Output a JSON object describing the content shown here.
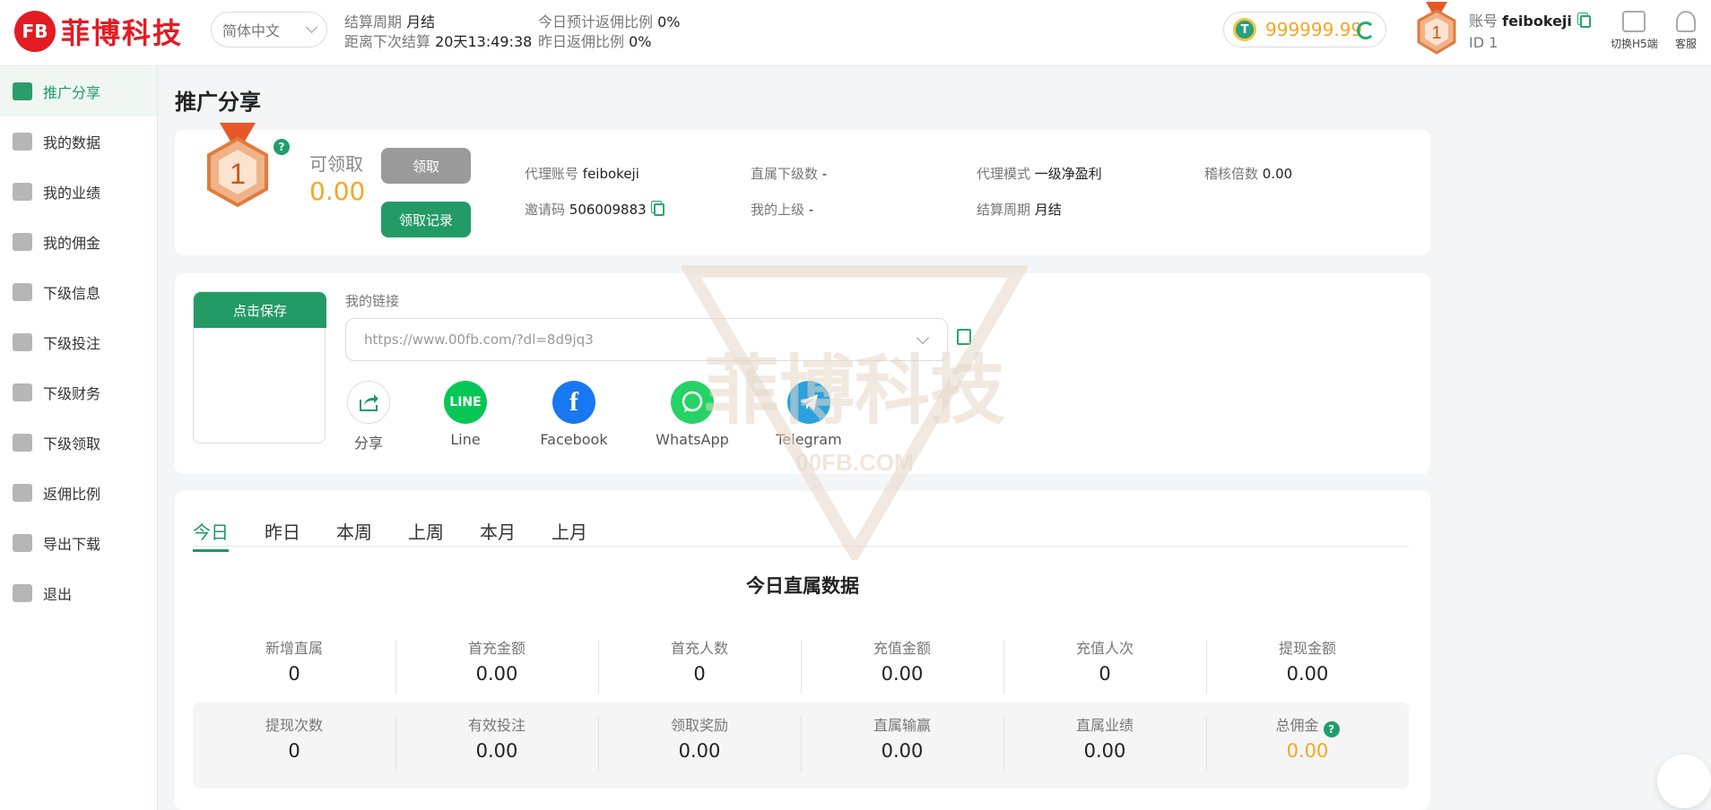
{
  "header": {
    "logo_mark": "FB",
    "logo_text": "菲博科技",
    "language": "简体中文",
    "settle_label": "结算周期",
    "settle_value": "月结",
    "next_settle_label": "距离下次结算",
    "next_settle_value": "20天13:49:38",
    "today_rate_label": "今日预计返佣比例",
    "today_rate_value": "0%",
    "yesterday_rate_label": "昨日返佣比例",
    "yesterday_rate_value": "0%",
    "coin_symbol": "T",
    "balance": "999999.99",
    "level": "1",
    "account_label": "账号",
    "account_value": "feibokeji",
    "id_text": "ID 1",
    "switch_h5": "切换H5端",
    "service": "客服"
  },
  "sidebar": {
    "items": [
      {
        "label": "推广分享",
        "active": true
      },
      {
        "label": "我的数据"
      },
      {
        "label": "我的业绩"
      },
      {
        "label": "我的佣金"
      },
      {
        "label": "下级信息"
      },
      {
        "label": "下级投注"
      },
      {
        "label": "下级财务"
      },
      {
        "label": "下级领取"
      },
      {
        "label": "返佣比例"
      },
      {
        "label": "导出下载"
      },
      {
        "label": "退出"
      }
    ]
  },
  "main": {
    "title": "推广分享",
    "claim": {
      "level": "1",
      "label": "可领取",
      "amount": "0.00",
      "claim_button": "领取",
      "record_button": "领取记录"
    },
    "info": {
      "agent_account_label": "代理账号",
      "agent_account_value": "feibokeji",
      "direct_count_label": "直属下级数",
      "direct_count_value": "-",
      "agent_mode_label": "代理模式",
      "agent_mode_value": "一级净盈利",
      "audit_label": "稽核倍数",
      "audit_value": "0.00",
      "invite_label": "邀请码",
      "invite_value": "506009883",
      "superior_label": "我的上级",
      "superior_value": "-",
      "settle_label": "结算周期",
      "settle_value": "月结"
    },
    "share": {
      "save_button": "点击保存",
      "link_label": "我的链接",
      "link_value": "https://www.00fb.com/?dl=8d9jq3",
      "targets": [
        {
          "label": "分享",
          "icon": "share-icon",
          "color": "#ffffff"
        },
        {
          "label": "Line",
          "icon": "line-icon",
          "color": "#06c755"
        },
        {
          "label": "Facebook",
          "icon": "facebook-icon",
          "color": "#1877f2"
        },
        {
          "label": "WhatsApp",
          "icon": "whatsapp-icon",
          "color": "#25d366"
        },
        {
          "label": "Telegram",
          "icon": "telegram-icon",
          "color": "#2aa1db"
        }
      ]
    },
    "tabs": [
      "今日",
      "昨日",
      "本周",
      "上周",
      "本月",
      "上月"
    ],
    "section_title": "今日直属数据",
    "stats_row1": [
      {
        "label": "新增直属",
        "value": "0"
      },
      {
        "label": "首充金额",
        "value": "0.00"
      },
      {
        "label": "首充人数",
        "value": "0"
      },
      {
        "label": "充值金额",
        "value": "0.00"
      },
      {
        "label": "充值人次",
        "value": "0"
      },
      {
        "label": "提现金额",
        "value": "0.00"
      }
    ],
    "stats_row2": [
      {
        "label": "提现次数",
        "value": "0"
      },
      {
        "label": "有效投注",
        "value": "0.00"
      },
      {
        "label": "领取奖励",
        "value": "0.00"
      },
      {
        "label": "直属输赢",
        "value": "0.00"
      },
      {
        "label": "直属业绩",
        "value": "0.00"
      },
      {
        "label": "总佣金",
        "value": "0.00"
      }
    ],
    "watermark_text": "菲博科技",
    "watermark_sub": "00FB.COM"
  },
  "colors": {
    "accent": "#1d9966",
    "gold": "#f5a623",
    "brand": "#e31b23"
  }
}
